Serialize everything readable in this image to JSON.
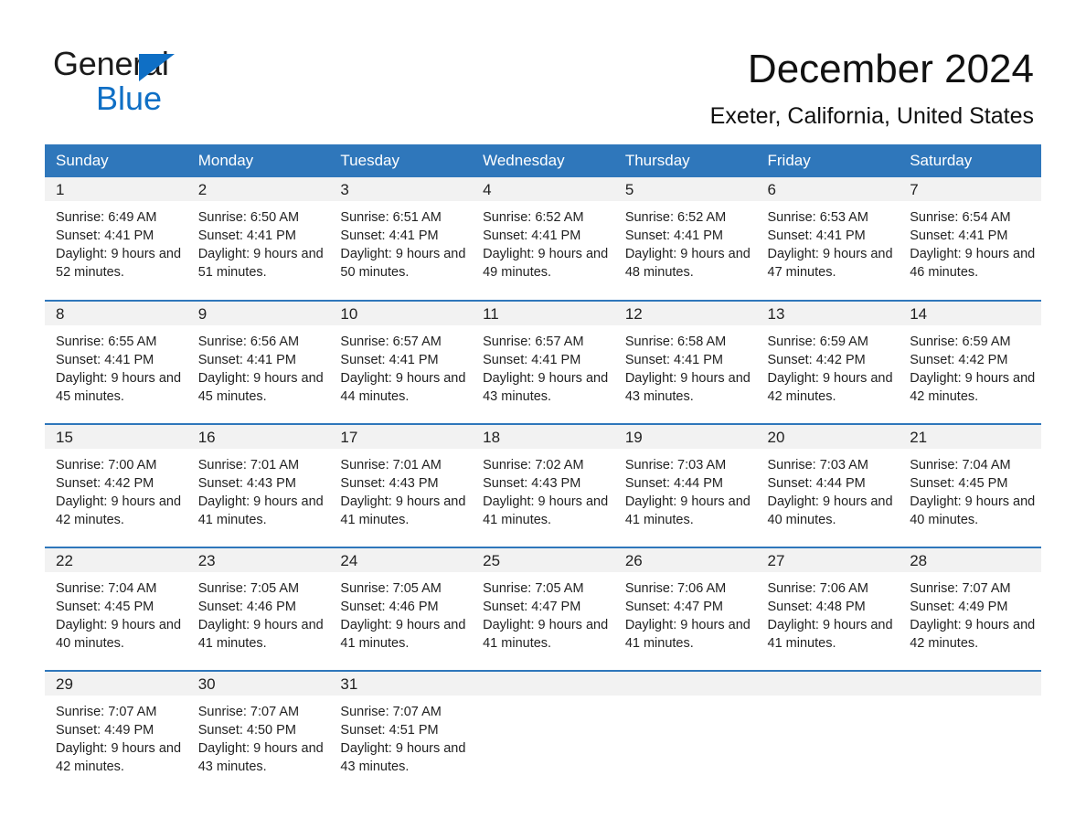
{
  "brand": {
    "line1": "General",
    "line2": "Blue",
    "triangle_color": "#0f6fc5"
  },
  "header": {
    "title": "December 2024",
    "subtitle": "Exeter, California, United States"
  },
  "theme": {
    "header_bg": "#2f77bb",
    "header_text": "#ffffff",
    "daynum_bg": "#f2f2f2",
    "row_divider": "#2f77bb",
    "body_text": "#222222"
  },
  "calendar": {
    "weekday_headers": [
      "Sunday",
      "Monday",
      "Tuesday",
      "Wednesday",
      "Thursday",
      "Friday",
      "Saturday"
    ],
    "weeks": [
      [
        {
          "day": "1",
          "sunrise": "Sunrise: 6:49 AM",
          "sunset": "Sunset: 4:41 PM",
          "daylight": "Daylight: 9 hours and 52 minutes."
        },
        {
          "day": "2",
          "sunrise": "Sunrise: 6:50 AM",
          "sunset": "Sunset: 4:41 PM",
          "daylight": "Daylight: 9 hours and 51 minutes."
        },
        {
          "day": "3",
          "sunrise": "Sunrise: 6:51 AM",
          "sunset": "Sunset: 4:41 PM",
          "daylight": "Daylight: 9 hours and 50 minutes."
        },
        {
          "day": "4",
          "sunrise": "Sunrise: 6:52 AM",
          "sunset": "Sunset: 4:41 PM",
          "daylight": "Daylight: 9 hours and 49 minutes."
        },
        {
          "day": "5",
          "sunrise": "Sunrise: 6:52 AM",
          "sunset": "Sunset: 4:41 PM",
          "daylight": "Daylight: 9 hours and 48 minutes."
        },
        {
          "day": "6",
          "sunrise": "Sunrise: 6:53 AM",
          "sunset": "Sunset: 4:41 PM",
          "daylight": "Daylight: 9 hours and 47 minutes."
        },
        {
          "day": "7",
          "sunrise": "Sunrise: 6:54 AM",
          "sunset": "Sunset: 4:41 PM",
          "daylight": "Daylight: 9 hours and 46 minutes."
        }
      ],
      [
        {
          "day": "8",
          "sunrise": "Sunrise: 6:55 AM",
          "sunset": "Sunset: 4:41 PM",
          "daylight": "Daylight: 9 hours and 45 minutes."
        },
        {
          "day": "9",
          "sunrise": "Sunrise: 6:56 AM",
          "sunset": "Sunset: 4:41 PM",
          "daylight": "Daylight: 9 hours and 45 minutes."
        },
        {
          "day": "10",
          "sunrise": "Sunrise: 6:57 AM",
          "sunset": "Sunset: 4:41 PM",
          "daylight": "Daylight: 9 hours and 44 minutes."
        },
        {
          "day": "11",
          "sunrise": "Sunrise: 6:57 AM",
          "sunset": "Sunset: 4:41 PM",
          "daylight": "Daylight: 9 hours and 43 minutes."
        },
        {
          "day": "12",
          "sunrise": "Sunrise: 6:58 AM",
          "sunset": "Sunset: 4:41 PM",
          "daylight": "Daylight: 9 hours and 43 minutes."
        },
        {
          "day": "13",
          "sunrise": "Sunrise: 6:59 AM",
          "sunset": "Sunset: 4:42 PM",
          "daylight": "Daylight: 9 hours and 42 minutes."
        },
        {
          "day": "14",
          "sunrise": "Sunrise: 6:59 AM",
          "sunset": "Sunset: 4:42 PM",
          "daylight": "Daylight: 9 hours and 42 minutes."
        }
      ],
      [
        {
          "day": "15",
          "sunrise": "Sunrise: 7:00 AM",
          "sunset": "Sunset: 4:42 PM",
          "daylight": "Daylight: 9 hours and 42 minutes."
        },
        {
          "day": "16",
          "sunrise": "Sunrise: 7:01 AM",
          "sunset": "Sunset: 4:43 PM",
          "daylight": "Daylight: 9 hours and 41 minutes."
        },
        {
          "day": "17",
          "sunrise": "Sunrise: 7:01 AM",
          "sunset": "Sunset: 4:43 PM",
          "daylight": "Daylight: 9 hours and 41 minutes."
        },
        {
          "day": "18",
          "sunrise": "Sunrise: 7:02 AM",
          "sunset": "Sunset: 4:43 PM",
          "daylight": "Daylight: 9 hours and 41 minutes."
        },
        {
          "day": "19",
          "sunrise": "Sunrise: 7:03 AM",
          "sunset": "Sunset: 4:44 PM",
          "daylight": "Daylight: 9 hours and 41 minutes."
        },
        {
          "day": "20",
          "sunrise": "Sunrise: 7:03 AM",
          "sunset": "Sunset: 4:44 PM",
          "daylight": "Daylight: 9 hours and 40 minutes."
        },
        {
          "day": "21",
          "sunrise": "Sunrise: 7:04 AM",
          "sunset": "Sunset: 4:45 PM",
          "daylight": "Daylight: 9 hours and 40 minutes."
        }
      ],
      [
        {
          "day": "22",
          "sunrise": "Sunrise: 7:04 AM",
          "sunset": "Sunset: 4:45 PM",
          "daylight": "Daylight: 9 hours and 40 minutes."
        },
        {
          "day": "23",
          "sunrise": "Sunrise: 7:05 AM",
          "sunset": "Sunset: 4:46 PM",
          "daylight": "Daylight: 9 hours and 41 minutes."
        },
        {
          "day": "24",
          "sunrise": "Sunrise: 7:05 AM",
          "sunset": "Sunset: 4:46 PM",
          "daylight": "Daylight: 9 hours and 41 minutes."
        },
        {
          "day": "25",
          "sunrise": "Sunrise: 7:05 AM",
          "sunset": "Sunset: 4:47 PM",
          "daylight": "Daylight: 9 hours and 41 minutes."
        },
        {
          "day": "26",
          "sunrise": "Sunrise: 7:06 AM",
          "sunset": "Sunset: 4:47 PM",
          "daylight": "Daylight: 9 hours and 41 minutes."
        },
        {
          "day": "27",
          "sunrise": "Sunrise: 7:06 AM",
          "sunset": "Sunset: 4:48 PM",
          "daylight": "Daylight: 9 hours and 41 minutes."
        },
        {
          "day": "28",
          "sunrise": "Sunrise: 7:07 AM",
          "sunset": "Sunset: 4:49 PM",
          "daylight": "Daylight: 9 hours and 42 minutes."
        }
      ],
      [
        {
          "day": "29",
          "sunrise": "Sunrise: 7:07 AM",
          "sunset": "Sunset: 4:49 PM",
          "daylight": "Daylight: 9 hours and 42 minutes."
        },
        {
          "day": "30",
          "sunrise": "Sunrise: 7:07 AM",
          "sunset": "Sunset: 4:50 PM",
          "daylight": "Daylight: 9 hours and 43 minutes."
        },
        {
          "day": "31",
          "sunrise": "Sunrise: 7:07 AM",
          "sunset": "Sunset: 4:51 PM",
          "daylight": "Daylight: 9 hours and 43 minutes."
        },
        {
          "day": "",
          "sunrise": "",
          "sunset": "",
          "daylight": ""
        },
        {
          "day": "",
          "sunrise": "",
          "sunset": "",
          "daylight": ""
        },
        {
          "day": "",
          "sunrise": "",
          "sunset": "",
          "daylight": ""
        },
        {
          "day": "",
          "sunrise": "",
          "sunset": "",
          "daylight": ""
        }
      ]
    ]
  }
}
